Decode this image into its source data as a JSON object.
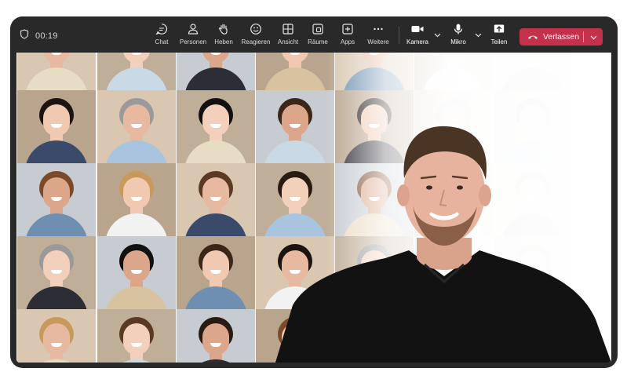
{
  "toolbar": {
    "timer": "00:19",
    "buttons": {
      "chat": "Chat",
      "people": "Personen",
      "raise": "Heben",
      "react": "Reagieren",
      "view": "Ansicht",
      "rooms": "Räume",
      "apps": "Apps",
      "more": "Weitere",
      "camera": "Kamera",
      "mic": "Mikro",
      "share": "Teilen"
    },
    "leave_label": "Verlassen"
  },
  "icons": {
    "shield": "shield-icon",
    "chat": "chat-icon",
    "people": "people-icon",
    "raise": "hand-icon",
    "react": "smiley-icon",
    "view": "grid-icon",
    "rooms": "rooms-icon",
    "apps": "plus-square-icon",
    "more": "ellipsis-icon",
    "camera": "camera-icon",
    "mic": "microphone-icon",
    "share": "share-upload-icon",
    "leave": "phone-hangup-icon"
  },
  "colors": {
    "toolbar_bg": "#292929",
    "leave_red": "#c4314b",
    "presenter_shirt": "#121212"
  }
}
